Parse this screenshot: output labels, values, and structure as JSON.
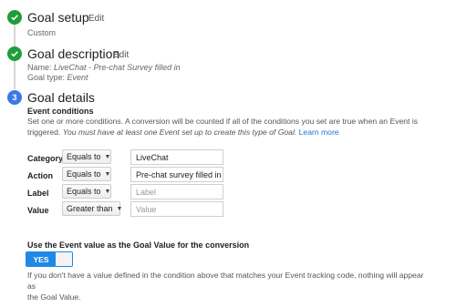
{
  "steps": {
    "setup": {
      "title": "Goal setup",
      "edit": "Edit",
      "sub": "Custom"
    },
    "description": {
      "title": "Goal description",
      "edit": "Edit",
      "name_label": "Name:",
      "name_value": "LiveChat - Pre-chat Survey filled in",
      "type_label": "Goal type:",
      "type_value": "Event"
    },
    "details": {
      "number": "3",
      "title": "Goal details"
    }
  },
  "event_conditions": {
    "heading": "Event conditions",
    "help_line1": "Set one or more conditions. A conversion will be counted if all of the conditions you set are true when an Event is",
    "help_line2_plain": "triggered. ",
    "help_line2_italic": "You must have at least one Event set up to create this type of Goal.",
    "learn_more": "Learn more"
  },
  "conditions": [
    {
      "label": "Category",
      "operator": "Equals to",
      "value": "LiveChat",
      "placeholder": ""
    },
    {
      "label": "Action",
      "operator": "Equals to",
      "value": "Pre-chat survey filled in",
      "placeholder": ""
    },
    {
      "label": "Label",
      "operator": "Equals to",
      "value": "",
      "placeholder": "Label"
    },
    {
      "label": "Value",
      "operator": "Greater than",
      "value": "",
      "placeholder": "Value"
    }
  ],
  "goal_value": {
    "heading": "Use the Event value as the Goal Value for the conversion",
    "toggle_label": "YES",
    "help_line1": "If you don't have a value defined in the condition above that matches your Event tracking code, nothing will appear as",
    "help_line2": "the Goal Value."
  },
  "colors": {
    "check": "#1e9e3a",
    "step_number": "#3b78e7",
    "toggle_on": "#1e88e5",
    "link": "#1a73e8"
  }
}
